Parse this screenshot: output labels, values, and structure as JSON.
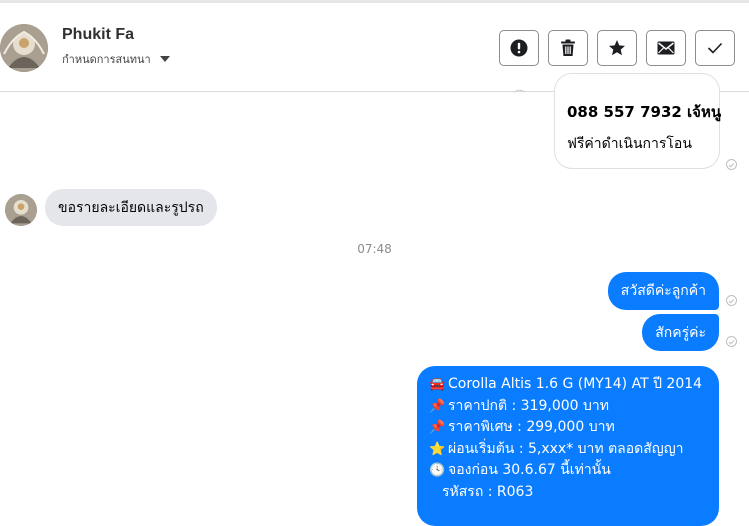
{
  "header": {
    "contact_name": "Phukit Fa",
    "manage_label": "กำหนดการสนทนา",
    "actions": [
      {
        "name": "report",
        "icon": "alert-circle-icon"
      },
      {
        "name": "delete",
        "icon": "trash-icon"
      },
      {
        "name": "star",
        "icon": "star-icon"
      },
      {
        "name": "mark-unread",
        "icon": "envelope-icon"
      },
      {
        "name": "mark-done",
        "icon": "check-icon"
      }
    ]
  },
  "messages": {
    "top_bubble": {
      "line1": "088 557 7932 เจ้หนู",
      "line2": "ฟรีค่าดำเนินการโอน"
    },
    "received": "ขอรายละเอียดและรูปรถ",
    "timestamp": "07:48",
    "sent1": "สวัสดีค่ะลูกค้า",
    "sent2": "สักครู่ค่ะ",
    "sent3": {
      "lines": [
        {
          "emoji": "🚘",
          "text": "Corolla Altis 1.6 G (MY14) AT ปี 2014"
        },
        {
          "emoji": "📌",
          "text": "ราคาปกติ : 319,000 บาท"
        },
        {
          "emoji": "📌",
          "text": "ราคาพิเศษ : 299,000 บาท"
        },
        {
          "emoji": "⭐",
          "text": "ผ่อนเริ่มต้น : 5,xxx* บาท ตลอดสัญญา"
        },
        {
          "emoji": "🕓",
          "text": "จองก่อน 30.6.67 นี้เท่านั้น"
        },
        {
          "emoji": "",
          "text": "รหัสรถ : R063"
        }
      ]
    }
  },
  "colors": {
    "sent_bubble": "#0a7cff",
    "received_bubble": "#e4e6eb"
  }
}
